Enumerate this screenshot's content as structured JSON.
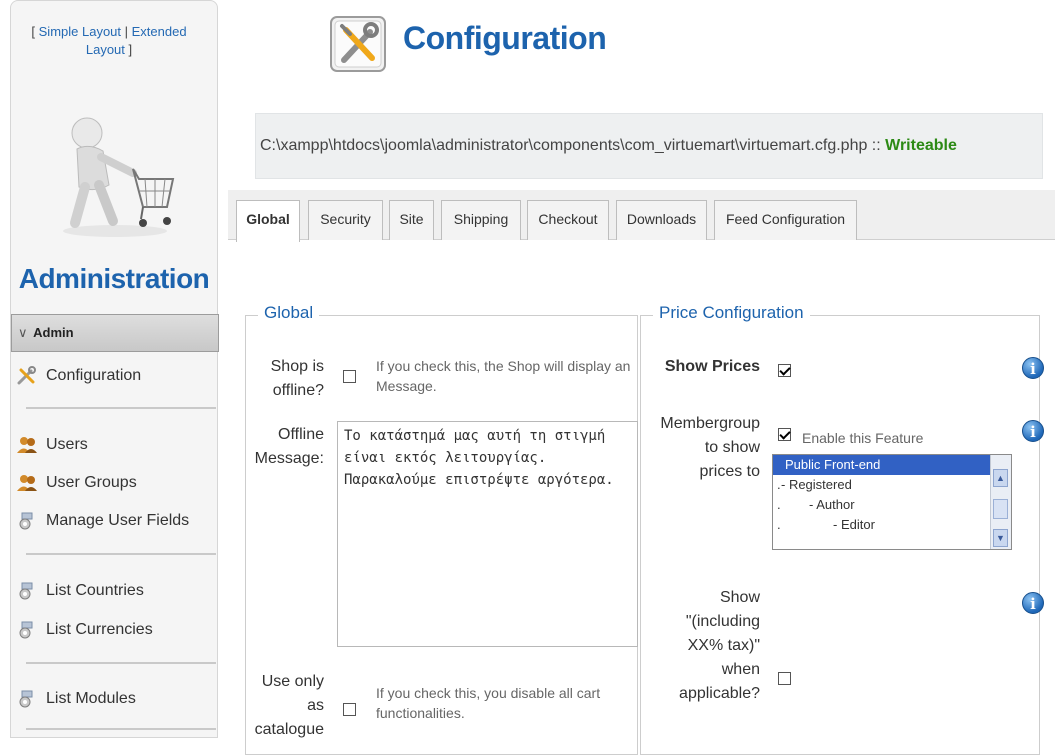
{
  "sidebar": {
    "layout_links": {
      "open": "[ ",
      "simple": "Simple Layout",
      "divider": " | ",
      "extended": "Extended Layout",
      "close": " ]"
    },
    "title": "Administration",
    "section": {
      "chevron": "∨",
      "label": "Admin"
    },
    "items": [
      {
        "label": "Configuration",
        "icon": "tools-icon"
      },
      {
        "label": "Users",
        "icon": "users-icon"
      },
      {
        "label": "User Groups",
        "icon": "user-groups-icon"
      },
      {
        "label": "Manage User Fields",
        "icon": "gear-icon"
      },
      {
        "label": "List Countries",
        "icon": "gear-icon"
      },
      {
        "label": "List Currencies",
        "icon": "gear-icon"
      },
      {
        "label": "List Modules",
        "icon": "gear-icon"
      }
    ]
  },
  "header": {
    "title": "Configuration",
    "path": "C:\\xampp\\htdocs\\joomla\\administrator\\components\\com_virtuemart\\virtuemart.cfg.php",
    "path_sep": " :: ",
    "status": "Writeable"
  },
  "tabs": [
    {
      "label": "Global",
      "active": true
    },
    {
      "label": "Security"
    },
    {
      "label": "Site"
    },
    {
      "label": "Shipping"
    },
    {
      "label": "Checkout"
    },
    {
      "label": "Downloads"
    },
    {
      "label": "Feed Configuration"
    }
  ],
  "global": {
    "legend": "Global",
    "offline": {
      "label_1": "Shop is",
      "label_2": "offline?",
      "hint_1": "If you check this, the Shop will display an",
      "hint_2": "Message.",
      "checked": false
    },
    "offline_message": {
      "label_1": "Offline",
      "label_2": "Message:",
      "value": "Το κατάστημά μας αυτή τη στιγμή\nείναι εκτός λειτουργίας.\nΠαρακαλούμε επιστρέψτε αργότερα."
    },
    "catalogue": {
      "label_1": "Use only",
      "label_2": "as",
      "label_3": "catalogue",
      "hint_1": "If you check this, you disable all cart",
      "hint_2": "functionalities.",
      "checked": false
    }
  },
  "price": {
    "legend": "Price Configuration",
    "show_prices": {
      "label": "Show Prices",
      "checked": true
    },
    "membergroup": {
      "label_1": "Membergroup",
      "label_2": "to show",
      "label_3": "prices to",
      "enable_label": "Enable this Feature",
      "checked": true,
      "options": [
        "Public Front-end",
        "- Registered",
        "- Author",
        "- Editor"
      ],
      "selected": "Public Front-end"
    },
    "tax": {
      "label_1": "Show",
      "label_2": "\"(including",
      "label_3": "XX% tax)\"",
      "label_4": "when",
      "label_5": "applicable?",
      "checked": false
    },
    "info_symbol": "i"
  },
  "colors": {
    "accent_blue": "#1d63ad",
    "writeable_green": "#2c8a15",
    "selected_option": "#3161c4"
  }
}
